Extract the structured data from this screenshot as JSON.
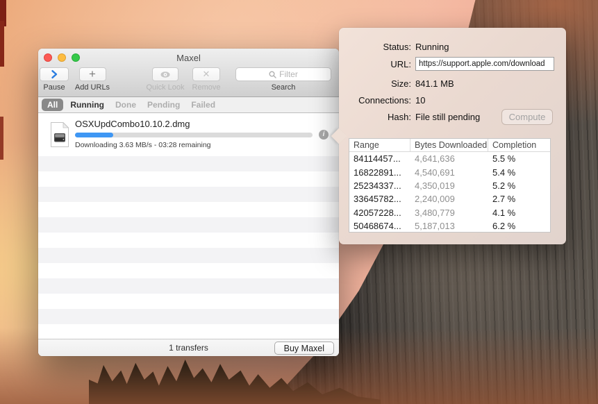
{
  "window": {
    "title": "Maxel",
    "toolbar": {
      "pause_label": "Pause",
      "add_urls_label": "Add URLs",
      "quick_look_label": "Quick Look",
      "remove_label": "Remove",
      "search_label": "Search",
      "filter_placeholder": "Filter"
    },
    "tabs": [
      {
        "label": "All",
        "selected": true
      },
      {
        "label": "Running",
        "selected": false
      },
      {
        "label": "Done",
        "selected": false
      },
      {
        "label": "Pending",
        "selected": false
      },
      {
        "label": "Failed",
        "selected": false
      }
    ],
    "download": {
      "filename": "OSXUpdCombo10.10.2.dmg",
      "status": "Downloading 3.63 MB/s - 03:28 remaining",
      "progress_percent": 16
    },
    "footer": {
      "transfers_label": "1 transfers",
      "buy_button_label": "Buy Maxel"
    }
  },
  "popover": {
    "fields": [
      {
        "label": "Status:",
        "value": "Running"
      },
      {
        "label": "URL:",
        "value": "https://support.apple.com/download"
      },
      {
        "label": "Size:",
        "value": "841.1 MB"
      },
      {
        "label": "Connections:",
        "value": "10"
      },
      {
        "label": "Hash:",
        "value": "File still pending"
      }
    ],
    "compute_button_label": "Compute",
    "table": {
      "headers": [
        "Range",
        "Bytes Downloaded",
        "Completion"
      ],
      "rows": [
        {
          "range": "84114457...",
          "bytes": "4,641,636",
          "completion": "5.5 %"
        },
        {
          "range": "16822891...",
          "bytes": "4,540,691",
          "completion": "5.4 %"
        },
        {
          "range": "25234337...",
          "bytes": "4,350,019",
          "completion": "5.2 %"
        },
        {
          "range": "33645782...",
          "bytes": "2,240,009",
          "completion": "2.7 %"
        },
        {
          "range": "42057228...",
          "bytes": "3,480,779",
          "completion": "4.1 %"
        },
        {
          "range": "50468674...",
          "bytes": "5,187,013",
          "completion": "6.2 %"
        }
      ]
    }
  },
  "colors": {
    "accent_blue": "#2b7de0",
    "progress_fill": "#3f97f4",
    "traffic_red": "#fc5a54",
    "traffic_yellow": "#fdbc40",
    "traffic_green": "#35c94a",
    "popover_bg": "#ead9d0"
  }
}
